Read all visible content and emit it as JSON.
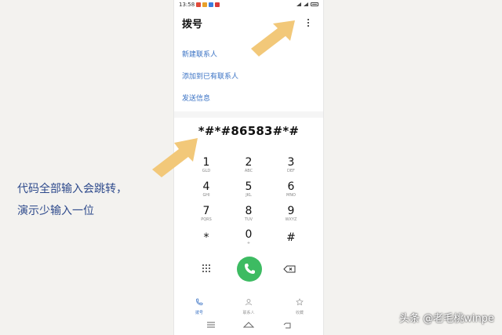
{
  "status_bar": {
    "time": "13:58"
  },
  "header": {
    "title": "拨号"
  },
  "menu": {
    "new_contact": "新建联系人",
    "add_to_existing": "添加到已有联系人",
    "send_message": "发送信息"
  },
  "dialer": {
    "number": "*#*#86583#*#",
    "keys": [
      {
        "digit": "1",
        "letters": "GLD"
      },
      {
        "digit": "2",
        "letters": "ABC"
      },
      {
        "digit": "3",
        "letters": "DEF"
      },
      {
        "digit": "4",
        "letters": "GHI"
      },
      {
        "digit": "5",
        "letters": "JKL"
      },
      {
        "digit": "6",
        "letters": "MNO"
      },
      {
        "digit": "7",
        "letters": "PQRS"
      },
      {
        "digit": "8",
        "letters": "TUV"
      },
      {
        "digit": "9",
        "letters": "WXYZ"
      },
      {
        "digit": "*",
        "letters": ""
      },
      {
        "digit": "0",
        "letters": "+"
      },
      {
        "digit": "#",
        "letters": ""
      }
    ]
  },
  "bottom_tabs": {
    "dial": "拨号",
    "contacts": "联系人",
    "favorites": "收藏"
  },
  "annotation": {
    "line1": "代码全部输入会跳转，",
    "line2": "演示少输入一位"
  },
  "watermark": "头条 @老毛桃winpe",
  "colors": {
    "accent": "#3a72c4",
    "call_green": "#3dbb62",
    "arrow": "#f2c879",
    "caption": "#2e4a8c"
  }
}
